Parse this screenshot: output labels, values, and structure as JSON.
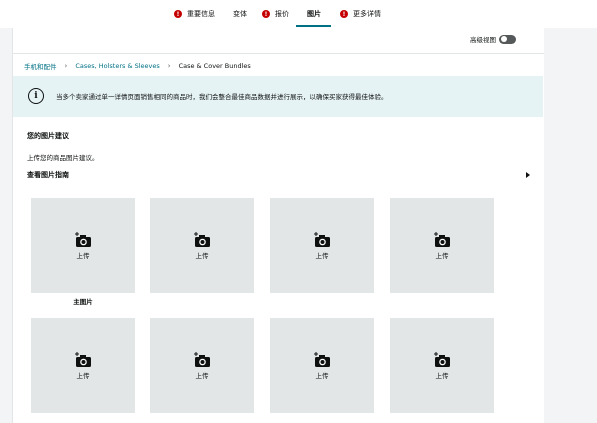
{
  "tabs": [
    {
      "label": "重要信息",
      "error": true
    },
    {
      "label": "变体",
      "error": false
    },
    {
      "label": "报价",
      "error": true
    },
    {
      "label": "图片",
      "error": false,
      "active": true
    },
    {
      "label": "更多详情",
      "error": true
    }
  ],
  "error_badge": "!",
  "advanced_view": {
    "label": "高级视图",
    "enabled": false
  },
  "breadcrumb": {
    "items": [
      "手机和配件",
      "Cases, Holsters & Sleeves",
      "Case & Cover Bundles"
    ],
    "separator": "›"
  },
  "info": {
    "icon": "info-icon",
    "glyph": "i",
    "text": "当多个卖家通过单一详情页面销售相同的商品时，我们会整合最佳商品数据并进行展示，以确保买家获得最佳体验。"
  },
  "section": {
    "title": "您的图片建议",
    "subtitle": "上传您的商品图片建议。",
    "guide_label": "查看图片指南"
  },
  "slots": [
    {
      "label": "上传",
      "caption": "主图片"
    },
    {
      "label": "上传",
      "caption": ""
    },
    {
      "label": "上传",
      "caption": ""
    },
    {
      "label": "上传",
      "caption": ""
    },
    {
      "label": "上传",
      "caption": ""
    },
    {
      "label": "上传",
      "caption": ""
    },
    {
      "label": "上传",
      "caption": ""
    },
    {
      "label": "上传",
      "caption": ""
    }
  ],
  "colors": {
    "accent": "#007185",
    "error": "#c40000",
    "info_bg": "#e6f3f5",
    "slot_bg": "#e3e6e6"
  }
}
